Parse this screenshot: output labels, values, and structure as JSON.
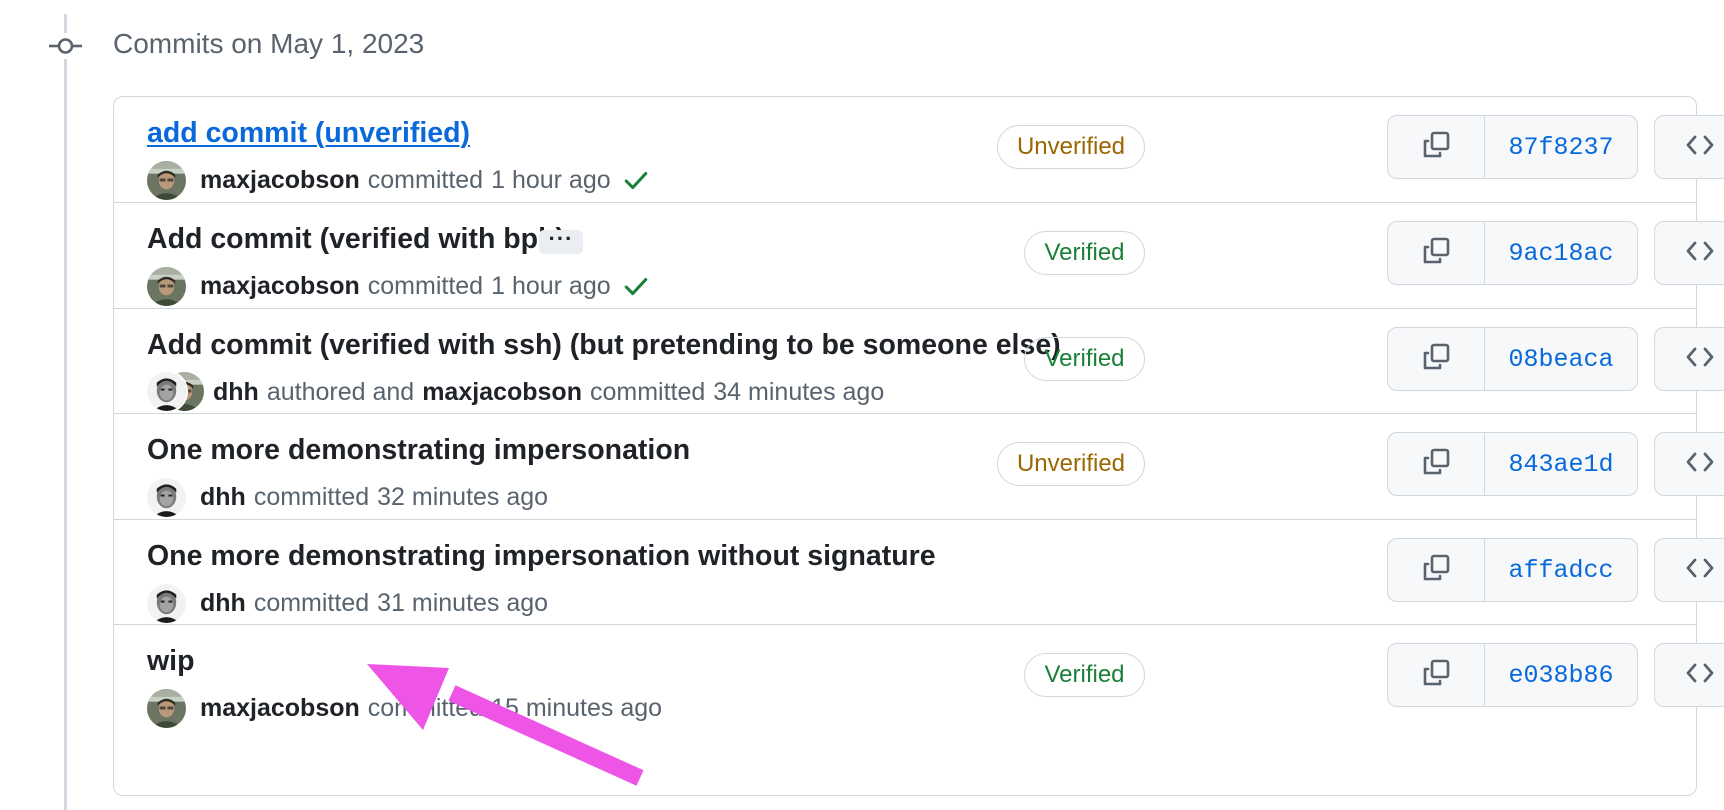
{
  "group": {
    "header": "Commits on May 1, 2023"
  },
  "colors": {
    "verified": "#1a7f37",
    "unverified": "#9a6700",
    "link": "#0969da",
    "annotation_arrow": "#ee55e6"
  },
  "commits": [
    {
      "title": "add commit (unverified)",
      "title_is_link": true,
      "meta": {
        "user": "maxjacobson",
        "action": "committed",
        "time": "1 hour ago",
        "check": true
      },
      "badge": "Unverified",
      "sha": "87f8237"
    },
    {
      "title": "Add commit (verified with bpb)",
      "ellipsis": "···",
      "meta": {
        "user": "maxjacobson",
        "action": "committed",
        "time": "1 hour ago",
        "check": true
      },
      "badge": "Verified",
      "sha": "9ac18ac"
    },
    {
      "title": "Add commit (verified with ssh) (but pretending to be someone else)",
      "meta": {
        "author": "dhh",
        "authored_text": "authored and",
        "committer": "maxjacobson",
        "action": "committed",
        "time": "34 minutes ago"
      },
      "badge": "Verified",
      "sha": "08beaca"
    },
    {
      "title": "One more demonstrating impersonation",
      "meta": {
        "user": "dhh",
        "action": "committed",
        "time": "32 minutes ago"
      },
      "badge": "Unverified",
      "sha": "843ae1d"
    },
    {
      "title": "One more demonstrating impersonation without signature",
      "meta": {
        "user": "dhh",
        "action": "committed",
        "time": "31 minutes ago"
      },
      "sha": "affadcc"
    },
    {
      "title": "wip",
      "meta": {
        "user": "maxjacobson",
        "action": "committed",
        "time": "15 minutes ago"
      },
      "badge": "Verified",
      "sha": "e038b86"
    }
  ],
  "icons": {
    "timeline": "git-commit-icon",
    "copy": "copy-icon",
    "browse": "code-icon",
    "check": "check-icon"
  }
}
